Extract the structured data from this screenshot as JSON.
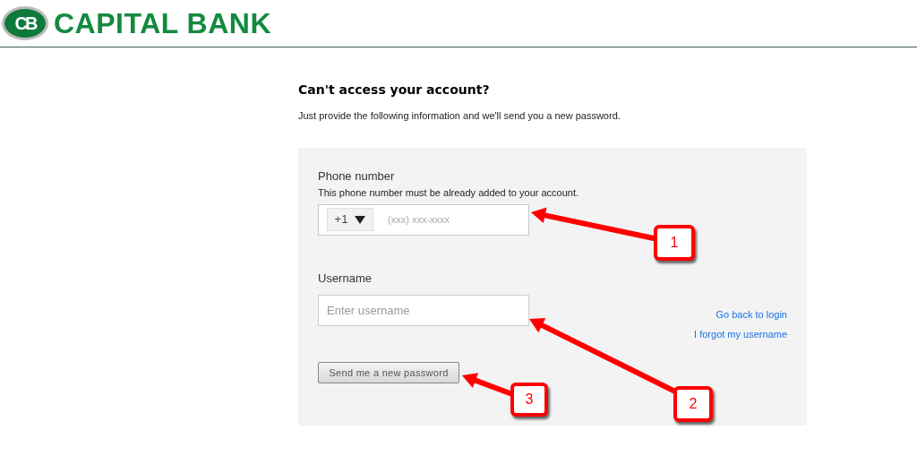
{
  "header": {
    "logo_monogram": "CB",
    "bank_name": "CAPITAL BANK"
  },
  "title": "Can't access your account?",
  "subtitle": "Just provide the following information and we'll send you a new password.",
  "form": {
    "phone_label": "Phone number",
    "phone_hint": "This phone number must be already added to your account.",
    "country_code": "+1",
    "phone_placeholder": "(xxx) xxx-xxxx",
    "username_label": "Username",
    "username_placeholder": "Enter username",
    "links": [
      "Go back to login",
      "I forgot my username"
    ],
    "submit": "Send me a new password"
  },
  "annotations": [
    {
      "label": "1"
    },
    {
      "label": "2"
    },
    {
      "label": "3"
    }
  ]
}
